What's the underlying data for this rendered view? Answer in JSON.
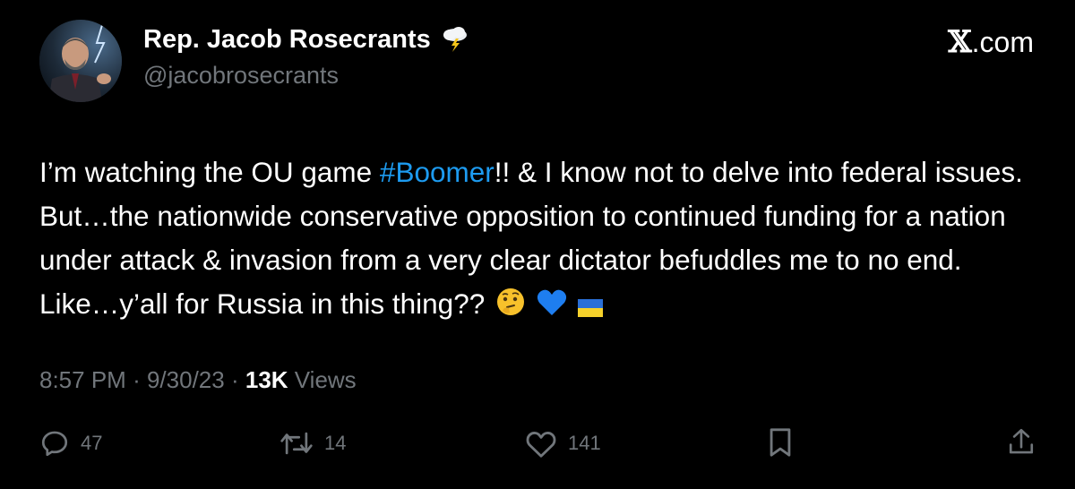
{
  "author": {
    "display_name": "Rep. Jacob Rosecrants",
    "handle": "@jacobrosecrants",
    "name_emoji": "cloud-with-lightning-icon"
  },
  "source": {
    "label": ".com"
  },
  "tweet": {
    "text_before_hashtag": "I’m watching the OU game ",
    "hashtag": "#Boomer",
    "text_after_hashtag": "!! & I know not to delve into federal issues. But…the nationwide conservative opposition to continued funding for a nation under attack & invasion from a very clear dictator befuddles me to no end. Like…y’all for Russia in this thing??",
    "emojis": [
      "thinking-face-icon",
      "blue-heart-icon",
      "ukraine-flag-icon"
    ]
  },
  "meta": {
    "time": "8:57 PM",
    "date": "9/30/23",
    "separator": "·",
    "views_count": "13K",
    "views_label": "Views"
  },
  "actions": {
    "replies": "47",
    "reposts": "14",
    "likes": "141"
  },
  "colors": {
    "background": "#000000",
    "text": "#ffffff",
    "secondary": "#71767b",
    "link": "#1d9bf0"
  }
}
